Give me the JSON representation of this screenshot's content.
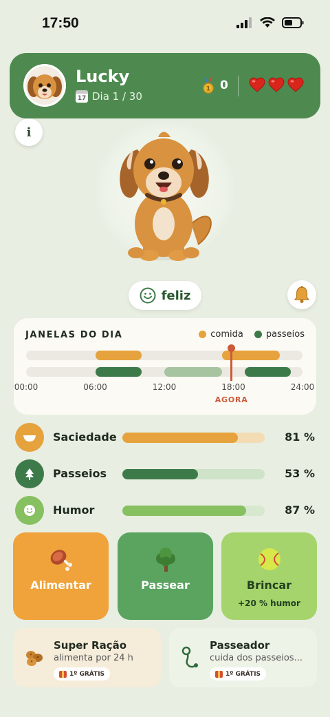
{
  "status": {
    "time": "17:50"
  },
  "header": {
    "pet_name": "Lucky",
    "day_label": "Dia 1 / 30",
    "calendar_day": "17",
    "medal_count": "0",
    "hearts": 3
  },
  "info_button": {
    "label": "i"
  },
  "mood": {
    "label": "feliz"
  },
  "windows": {
    "title": "JANELAS DO DIA",
    "legend": [
      {
        "label": "comida",
        "color": "#e6a23c"
      },
      {
        "label": "passeios",
        "color": "#3d7a4a"
      }
    ],
    "ticks": [
      "00:00",
      "06:00",
      "12:00",
      "18:00",
      "24:00"
    ],
    "now_label": "AGORA",
    "now_hour": 17.83,
    "food_windows": [
      {
        "start": 6,
        "end": 10
      },
      {
        "start": 17,
        "end": 22
      }
    ],
    "walk_windows": [
      {
        "start": 6,
        "end": 10,
        "state": "active"
      },
      {
        "start": 12,
        "end": 17,
        "state": "past"
      },
      {
        "start": 19,
        "end": 23,
        "state": "active"
      }
    ]
  },
  "stats": [
    {
      "label": "Saciedade",
      "value": "81 %",
      "fraction": 0.81,
      "color": "#e6a23c",
      "track": "#f3dcb4",
      "icon_bg": "#e6a23c",
      "icon": "bowl-icon"
    },
    {
      "label": "Passeios",
      "value": "53 %",
      "fraction": 0.53,
      "color": "#3d7a4a",
      "track": "#cfe3c9",
      "icon_bg": "#3d7a4a",
      "icon": "tree-icon"
    },
    {
      "label": "Humor",
      "value": "87 %",
      "fraction": 0.87,
      "color": "#86c060",
      "track": "#d6e8cd",
      "icon_bg": "#86c060",
      "icon": "smiley-icon"
    }
  ],
  "actions": [
    {
      "label": "Alimentar",
      "sub": "",
      "bg": "#f0a33a",
      "fg": "#ffffff",
      "icon": "meat-icon"
    },
    {
      "label": "Passear",
      "sub": "",
      "bg": "#5aa460",
      "fg": "#ffffff",
      "icon": "tree-icon"
    },
    {
      "label": "Brincar",
      "sub": "+20 % humor",
      "bg": "#a5d46c",
      "fg": "#23401f",
      "icon": "ball-icon"
    }
  ],
  "promos": [
    {
      "title": "Super Ração",
      "desc": "alimenta por 24 h",
      "badge": "1º GRÁTIS",
      "bg": "#f6ecda",
      "icon": "kibble-icon"
    },
    {
      "title": "Passeador",
      "desc": "cuida dos passeios...",
      "badge": "1º GRÁTIS",
      "bg": "#eef3e8",
      "icon": "leash-icon"
    }
  ]
}
